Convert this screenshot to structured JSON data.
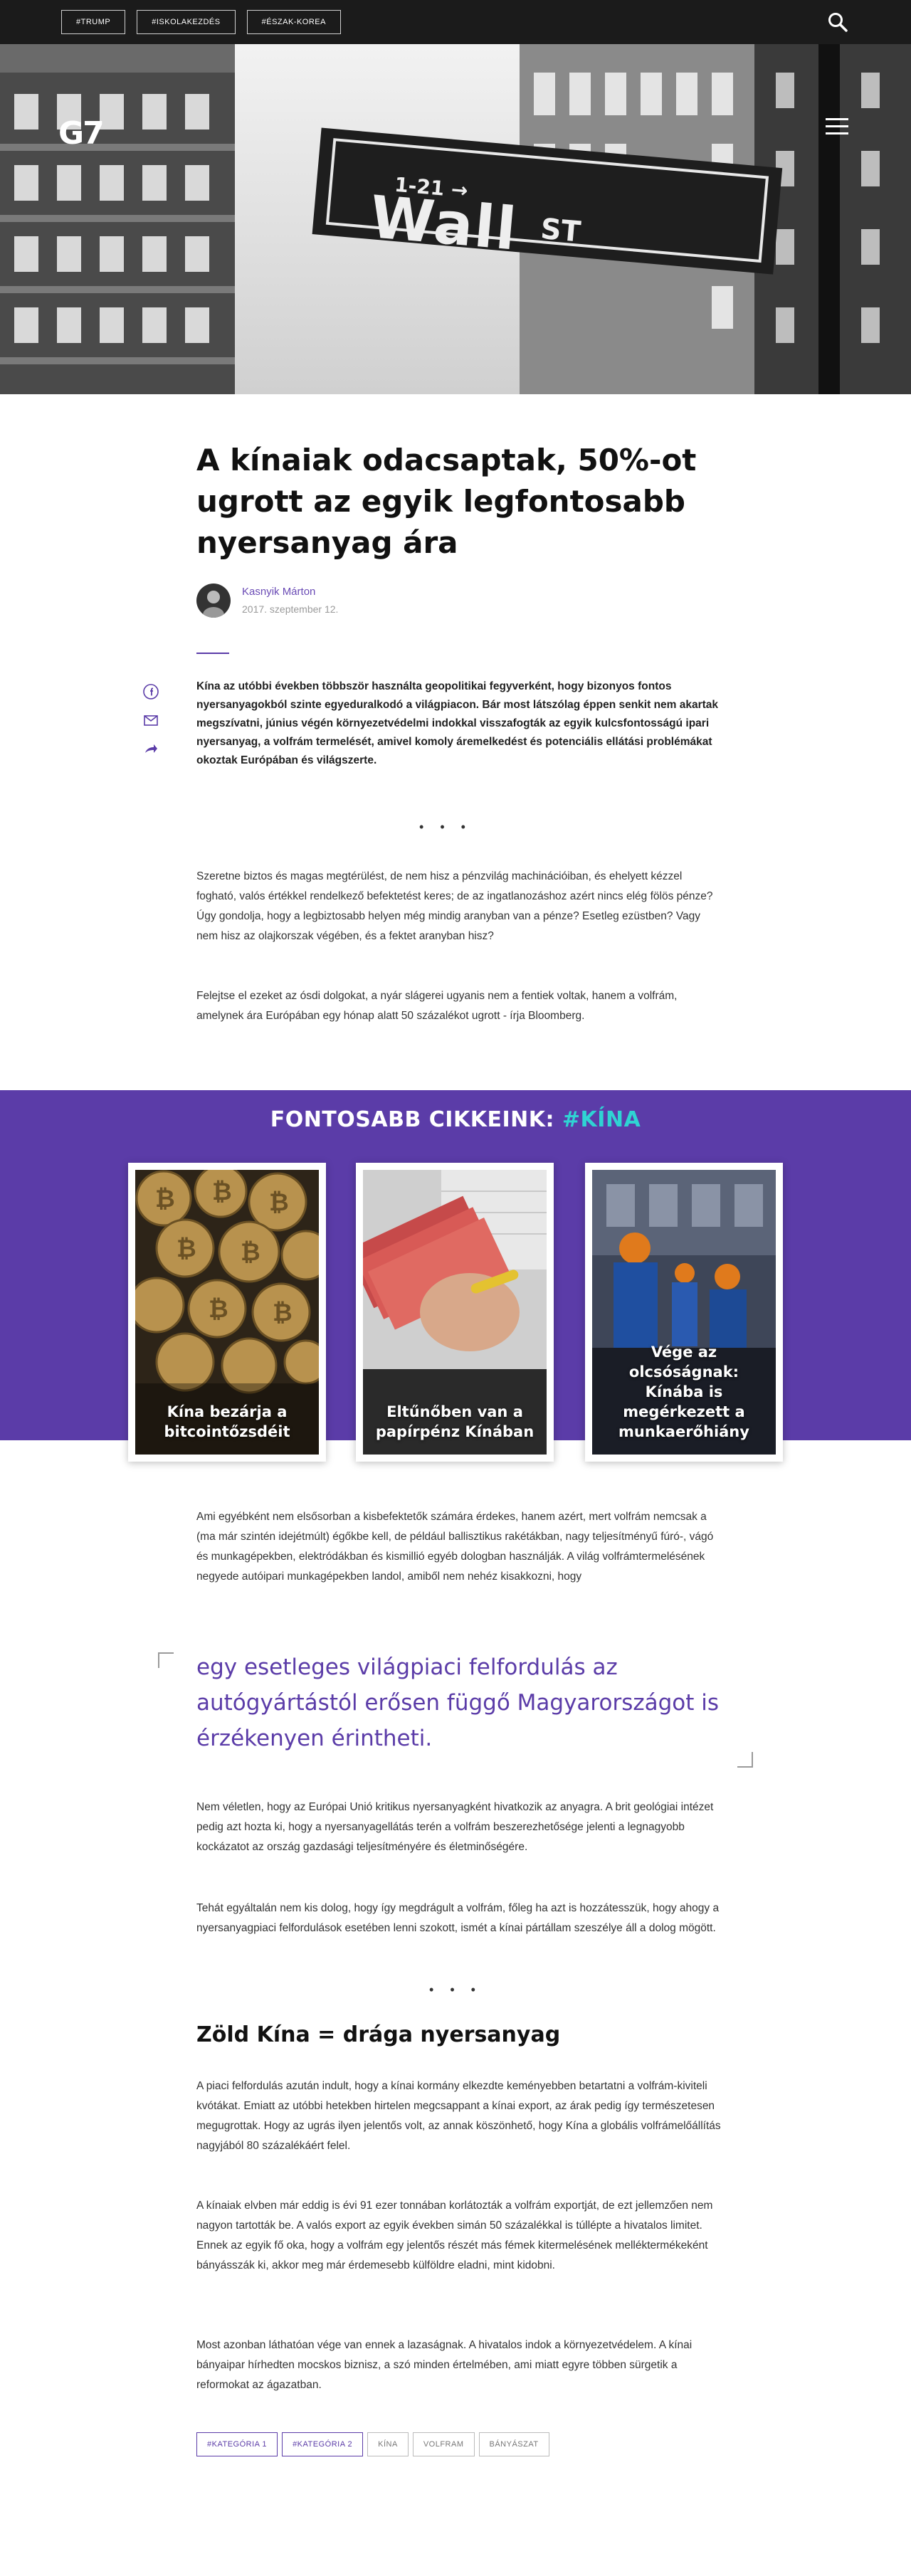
{
  "topbar": {
    "tags": [
      "#TRUMP",
      "#ISKOLAKEZDÉS",
      "#ÉSZAK-KOREA"
    ]
  },
  "hero": {
    "logo": "G7",
    "sign_text": "Wall",
    "sign_st": "ST",
    "sign_small": "1-21 →"
  },
  "article": {
    "title": "A kínaiak odacsaptak, 50%-ot ugrott az egyik legfontosabb nyersanyag ára",
    "author": "Kasnyik Márton",
    "date": "2017. szeptember 12.",
    "lead": "Kína az utóbbi években többször használta geopolitikai fegyverként, hogy bizonyos fontos nyersanyagokból szinte egyeduralkodó a világpiacon. Bár most látszólag éppen senkit nem akartak megszívatni, június végén környezetvédelmi indokkal visszafogták az egyik kulcsfontosságú ipari nyersanyag, a volfrám termelését, amivel komoly áremelkedést és potenciális ellátási problémákat okoztak Európában és világszerte.",
    "dots": "• • •",
    "p1": "Szeretne biztos és magas megtérülést, de nem hisz a pénzvilág machinációiban, és ehelyett kézzel fogható, valós értékkel rendelkező befektetést keres; de az ingatlanozáshoz azért nincs elég fölös pénze? Úgy gondolja, hogy a legbiztosabb helyen még mindig aranyban van a pénze? Esetleg ezüstben? Vagy nem hisz az olajkorszak végében, és a fektet aranyban hisz?",
    "p2": "Felejtse el ezeket az ósdi dolgokat, a nyár slágerei ugyanis nem a fentiek voltak, hanem a volfrám, amelynek ára Európában egy hónap alatt 50 százalékot ugrott - írja Bloomberg.",
    "p3": "Ami egyébként nem elsősorban a kisbefektetők számára érdekes, hanem azért, mert volfrám nemcsak a (ma már szintén idejétmúlt) égőkbe kell, de például ballisztikus rakétákban, nagy teljesítményű fúró-, vágó és munkagépekben, elektródákban és kismillió egyéb dologban használják. A világ volfrámtermelésének negyede autóipari munkagépekben landol, amiből nem nehéz kisakkozni, hogy",
    "quote": "egy esetleges világpiaci felfordulás az autógyártástól erősen függő Magyarországot is érzékenyen érintheti.",
    "p4": "Nem véletlen, hogy az Európai Unió kritikus nyersanyagként hivatkozik az anyagra. A brit geológiai intézet pedig azt hozta ki, hogy a nyersanyagellátás terén a volfrám beszerezhetősége jelenti a legnagyobb kockázatot az ország gazdasági teljesítményére és életminőségére.",
    "p5": "Tehát egyáltalán nem kis dolog, hogy így megdrágult a volfrám, főleg ha azt is hozzátesszük, hogy ahogy a nyersanyagpiaci felfordulások esetében lenni szokott, ismét a kínai pártállam szeszélye áll a dolog mögött.",
    "h2": "Zöld Kína = drága nyersanyag",
    "p6": "A piaci felfordulás azután indult, hogy a kínai kormány elkezdte keményebben betartatni a volfrám-kiviteli kvótákat. Emiatt az utóbbi hetekben hirtelen megcsappant a kínai export, az árak pedig így természetesen megugrottak. Hogy az ugrás ilyen jelentős volt, az annak köszönhető, hogy Kína a globális volfrámelőállítás nagyjából 80 százalékáért felel.",
    "p7": "A kínaiak elvben már eddig is évi 91 ezer tonnában korlátozták a volfrám exportját, de ezt jellemzően nem nagyon tartották be. A valós export az egyik években simán 50 százalékkal is túllépte a hivatalos limitet. Ennek az egyik fő oka, hogy a volfrám egy jelentős részét más fémek kitermelésének melléktermékeként bányásszák ki, akkor meg már érdemesebb külföldre eladni, mint kidobni.",
    "p8": "Most azonban láthatóan vége van ennek a lazaságnak. A hivatalos indok a környezetvédelem. A kínai bányaipar hírhedten mocskos biznisz, a szó minden értelmében, ami miatt egyre többen sürgetik a reformokat az ágazatban."
  },
  "featured": {
    "title": "FONTOSABB CIKKEINK:",
    "accent": "#KÍNA",
    "cards": [
      {
        "caption": "Kína bezárja a bitcointőzsdéit"
      },
      {
        "caption": "Eltűnőben van a papírpénz Kínában"
      },
      {
        "caption": "Vége az olcsóságnak: Kínába is megérkezett a munkaerőhiány"
      }
    ]
  },
  "tags": [
    "#KATEGÓRIA 1",
    "#KATEGÓRIA 2",
    "KÍNA",
    "VOLFRAM",
    "BÁNYÁSZAT"
  ],
  "colors": {
    "accent": "#5b3ca8",
    "teal": "#2fd3d3",
    "topbar": "#1b1b1b"
  }
}
